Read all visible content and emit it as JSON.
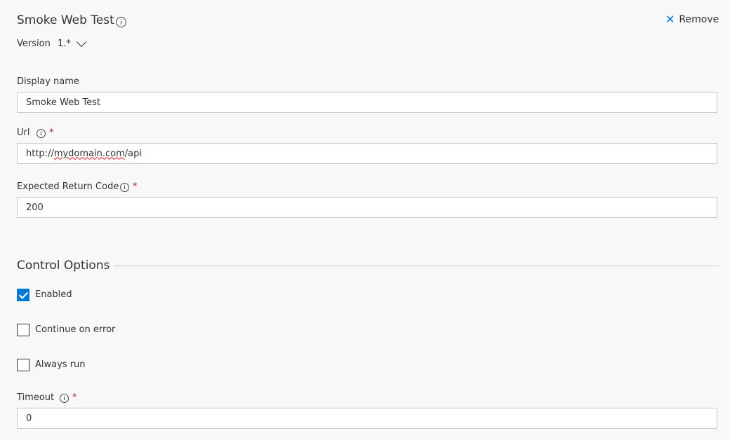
{
  "header": {
    "title": "Smoke Web Test",
    "remove_label": "Remove",
    "version_label": "Version",
    "version_value": "1.*"
  },
  "fields": {
    "display_name": {
      "label": "Display name",
      "value": "Smoke Web Test"
    },
    "url": {
      "label": "Url",
      "required": "*",
      "value_prefix": "http://",
      "value_domain": "mydomain.com",
      "value_suffix": "/api"
    },
    "expected_return_code": {
      "label": "Expected Return Code",
      "required": "*",
      "value": "200"
    },
    "timeout": {
      "label": "Timeout",
      "required": "*",
      "value": "0"
    }
  },
  "control_options": {
    "title": "Control Options",
    "enabled": {
      "label": "Enabled",
      "checked": true
    },
    "continue_on_error": {
      "label": "Continue on error",
      "checked": false
    },
    "always_run": {
      "label": "Always run",
      "checked": false
    }
  },
  "colors": {
    "accent": "#0078d4",
    "required": "#a4262c",
    "background": "#f8f8f8"
  }
}
